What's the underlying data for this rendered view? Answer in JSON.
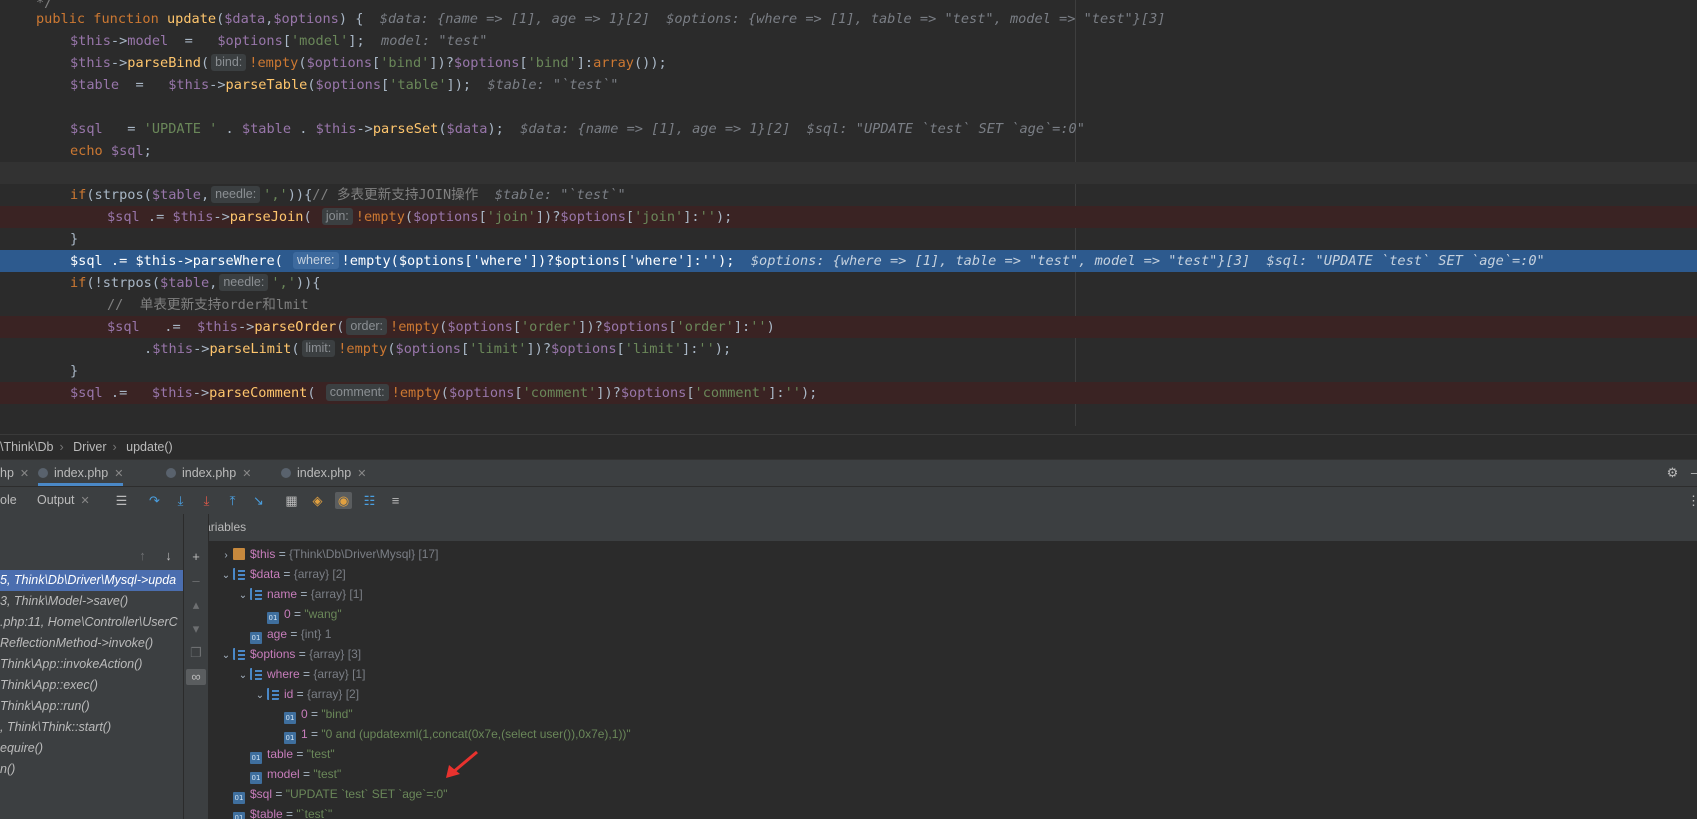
{
  "editor": {
    "lines": [
      {
        "tokens": [
          [
            "cmt",
            "*/"
          ]
        ]
      },
      {
        "tokens": [
          [
            "kw",
            "public function "
          ],
          [
            "fn",
            "update"
          ],
          [
            "plain",
            "("
          ],
          [
            "var",
            "$data"
          ],
          [
            "plain",
            ","
          ],
          [
            "var",
            "$options"
          ],
          [
            "plain",
            ") {  "
          ],
          [
            "inl",
            "$data: {name => [1], age => 1}[2]  $options: {where => [1], table => \"test\", model => \"test\"}[3]"
          ]
        ]
      },
      {
        "tokens": [
          [
            "var",
            "$this"
          ],
          [
            "plain",
            "->"
          ],
          [
            "var",
            "model"
          ],
          [
            "plain",
            "  =   "
          ],
          [
            "var",
            "$options"
          ],
          [
            "plain",
            "["
          ],
          [
            "str",
            "'model'"
          ],
          [
            "plain",
            "];  "
          ],
          [
            "inl",
            "model: \"test\""
          ]
        ]
      },
      {
        "tokens": [
          [
            "var",
            "$this"
          ],
          [
            "plain",
            "->"
          ],
          [
            "fn",
            "parseBind"
          ],
          [
            "plain",
            "("
          ],
          [
            "hint",
            "bind:"
          ],
          [
            "kw",
            "!empty"
          ],
          [
            "plain",
            "("
          ],
          [
            "var",
            "$options"
          ],
          [
            "plain",
            "["
          ],
          [
            "str",
            "'bind'"
          ],
          [
            "plain",
            "])?"
          ],
          [
            "var",
            "$options"
          ],
          [
            "plain",
            "["
          ],
          [
            "str",
            "'bind'"
          ],
          [
            "plain",
            "]:"
          ],
          [
            "kw",
            "array"
          ],
          [
            "plain",
            "());"
          ]
        ]
      },
      {
        "tokens": [
          [
            "var",
            "$table"
          ],
          [
            "plain",
            "  =   "
          ],
          [
            "var",
            "$this"
          ],
          [
            "plain",
            "->"
          ],
          [
            "fn",
            "parseTable"
          ],
          [
            "plain",
            "("
          ],
          [
            "var",
            "$options"
          ],
          [
            "plain",
            "["
          ],
          [
            "str",
            "'table'"
          ],
          [
            "plain",
            "]);  "
          ],
          [
            "inl",
            "$table: \"`test`\""
          ]
        ]
      },
      {
        "tokens": []
      },
      {
        "tokens": [
          [
            "var",
            "$sql"
          ],
          [
            "plain",
            "   = "
          ],
          [
            "str",
            "'UPDATE '"
          ],
          [
            "plain",
            " . "
          ],
          [
            "var",
            "$table"
          ],
          [
            "plain",
            " . "
          ],
          [
            "var",
            "$this"
          ],
          [
            "plain",
            "->"
          ],
          [
            "fn",
            "parseSet"
          ],
          [
            "plain",
            "("
          ],
          [
            "var",
            "$data"
          ],
          [
            "plain",
            ");  "
          ],
          [
            "inl",
            "$data: {name => [1], age => 1}[2]  $sql: \"UPDATE `test` SET `age`=:0\""
          ]
        ]
      },
      {
        "tokens": [
          [
            "kw",
            "echo "
          ],
          [
            "var",
            "$sql"
          ],
          [
            "plain",
            ";"
          ]
        ]
      },
      {
        "tokens": []
      },
      {
        "tokens": [
          [
            "kw",
            "if"
          ],
          [
            "plain",
            "(strpos("
          ],
          [
            "var",
            "$table"
          ],
          [
            "plain",
            ","
          ],
          [
            "hint",
            "needle:"
          ],
          [
            "str",
            "','"
          ],
          [
            "plain",
            "))"
          ],
          [
            "plain",
            "{"
          ],
          [
            "cmt",
            "// 多表更新支持JOIN操作  "
          ],
          [
            "inl",
            "$table: \"`test`\""
          ]
        ]
      },
      {
        "tokens": [
          [
            "var",
            "$sql"
          ],
          [
            "plain",
            " .= "
          ],
          [
            "var",
            "$this"
          ],
          [
            "plain",
            "->"
          ],
          [
            "fn",
            "parseJoin"
          ],
          [
            "plain",
            "( "
          ],
          [
            "hint",
            "join:"
          ],
          [
            "kw",
            "!empty"
          ],
          [
            "plain",
            "("
          ],
          [
            "var",
            "$options"
          ],
          [
            "plain",
            "["
          ],
          [
            "str",
            "'join'"
          ],
          [
            "plain",
            "])?"
          ],
          [
            "var",
            "$options"
          ],
          [
            "plain",
            "["
          ],
          [
            "str",
            "'join'"
          ],
          [
            "plain",
            "]:"
          ],
          [
            "str",
            "''"
          ],
          [
            "plain",
            ");"
          ]
        ]
      },
      {
        "tokens": [
          [
            "plain",
            "}"
          ]
        ]
      },
      {
        "tokens": [
          [
            "var",
            "$sql"
          ],
          [
            "plain",
            " .= "
          ],
          [
            "var",
            "$this"
          ],
          [
            "plain",
            "->"
          ],
          [
            "fn",
            "parseWhere"
          ],
          [
            "plain",
            "( "
          ],
          [
            "hint",
            "where:"
          ],
          [
            "kw",
            "!empty"
          ],
          [
            "plain",
            "("
          ],
          [
            "var",
            "$options"
          ],
          [
            "plain",
            "["
          ],
          [
            "str",
            "'where'"
          ],
          [
            "plain",
            "])?"
          ],
          [
            "var",
            "$options"
          ],
          [
            "plain",
            "["
          ],
          [
            "str",
            "'where'"
          ],
          [
            "plain",
            "]:"
          ],
          [
            "str",
            "''"
          ],
          [
            "plain",
            ");  "
          ],
          [
            "inl",
            "$options: {where => [1], table => \"test\", model => \"test\"}[3]  $sql: \"UPDATE `test` SET `age`=:0\""
          ]
        ]
      },
      {
        "tokens": [
          [
            "kw",
            "if"
          ],
          [
            "plain",
            "(!strpos("
          ],
          [
            "var",
            "$table"
          ],
          [
            "plain",
            ","
          ],
          [
            "hint",
            "needle:"
          ],
          [
            "str",
            "','"
          ],
          [
            "plain",
            ")){"
          ]
        ]
      },
      {
        "tokens": [
          [
            "cmt",
            "//  单表更新支持order和lmit"
          ]
        ]
      },
      {
        "tokens": [
          [
            "var",
            "$sql"
          ],
          [
            "plain",
            "   .=  "
          ],
          [
            "var",
            "$this"
          ],
          [
            "plain",
            "->"
          ],
          [
            "fn",
            "parseOrder"
          ],
          [
            "plain",
            "("
          ],
          [
            "hint",
            "order:"
          ],
          [
            "kw",
            "!empty"
          ],
          [
            "plain",
            "("
          ],
          [
            "var",
            "$options"
          ],
          [
            "plain",
            "["
          ],
          [
            "str",
            "'order'"
          ],
          [
            "plain",
            "])?"
          ],
          [
            "var",
            "$options"
          ],
          [
            "plain",
            "["
          ],
          [
            "str",
            "'order'"
          ],
          [
            "plain",
            "]:"
          ],
          [
            "str",
            "''"
          ],
          [
            "plain",
            ")"
          ]
        ]
      },
      {
        "tokens": [
          [
            "plain",
            "."
          ],
          [
            "var",
            "$this"
          ],
          [
            "plain",
            "->"
          ],
          [
            "fn",
            "parseLimit"
          ],
          [
            "plain",
            "("
          ],
          [
            "hint",
            "limit:"
          ],
          [
            "kw",
            "!empty"
          ],
          [
            "plain",
            "("
          ],
          [
            "var",
            "$options"
          ],
          [
            "plain",
            "["
          ],
          [
            "str",
            "'limit'"
          ],
          [
            "plain",
            "])?"
          ],
          [
            "var",
            "$options"
          ],
          [
            "plain",
            "["
          ],
          [
            "str",
            "'limit'"
          ],
          [
            "plain",
            "]:"
          ],
          [
            "str",
            "''"
          ],
          [
            "plain",
            ");"
          ]
        ]
      },
      {
        "tokens": [
          [
            "plain",
            "}"
          ]
        ]
      },
      {
        "tokens": [
          [
            "var",
            "$sql"
          ],
          [
            "plain",
            " .=   "
          ],
          [
            "var",
            "$this"
          ],
          [
            "plain",
            "->"
          ],
          [
            "fn",
            "parseComment"
          ],
          [
            "plain",
            "( "
          ],
          [
            "hint",
            "comment:"
          ],
          [
            "kw",
            "!empty"
          ],
          [
            "plain",
            "("
          ],
          [
            "var",
            "$options"
          ],
          [
            "plain",
            "["
          ],
          [
            "str",
            "'comment'"
          ],
          [
            "plain",
            "])?"
          ],
          [
            "var",
            "$options"
          ],
          [
            "plain",
            "["
          ],
          [
            "str",
            "'comment'"
          ],
          [
            "plain",
            "]:"
          ],
          [
            "str",
            "''"
          ],
          [
            "plain",
            ");"
          ]
        ]
      },
      {
        "tokens": []
      }
    ]
  },
  "breadcrumb": [
    "\\Think\\Db",
    "Driver",
    "update()"
  ],
  "file_tabs": [
    "hp",
    "index.php",
    "index.php",
    "index.php"
  ],
  "toolbar": {
    "console_label": "ole",
    "output_label": "Output"
  },
  "frames_panel": {
    "items": [
      "5, Think\\Db\\Driver\\Mysql->upda",
      "3, Think\\Model->save()",
      ".php:11, Home\\Controller\\UserC",
      "ReflectionMethod->invoke()",
      "Think\\App::invokeAction()",
      "Think\\App::exec()",
      "Think\\App::run()",
      ", Think\\Think::start()",
      "equire()",
      "n()"
    ]
  },
  "variables": {
    "header": "Variables",
    "rows": [
      {
        "name": "$this",
        "type": "{Think\\Db\\Driver\\Mysql} [17]",
        "value": ""
      },
      {
        "name": "$data",
        "type": "{array} [2]",
        "value": ""
      },
      {
        "name": "name",
        "type": "{array} [1]",
        "value": ""
      },
      {
        "name": "0",
        "type": "",
        "value": "\"wang\""
      },
      {
        "name": "age",
        "type": "{int} 1",
        "value": ""
      },
      {
        "name": "$options",
        "type": "{array} [3]",
        "value": ""
      },
      {
        "name": "where",
        "type": "{array} [1]",
        "value": ""
      },
      {
        "name": "id",
        "type": "{array} [2]",
        "value": ""
      },
      {
        "name": "0",
        "type": "",
        "value": "\"bind\""
      },
      {
        "name": "1",
        "type": "",
        "value": "\"0 and (updatexml(1,concat(0x7e,(select user()),0x7e),1))\""
      },
      {
        "name": "table",
        "type": "",
        "value": "\"test\""
      },
      {
        "name": "model",
        "type": "",
        "value": "\"test\""
      },
      {
        "name": "$sql",
        "type": "",
        "value": "\"UPDATE `test` SET `age`=:0\""
      },
      {
        "name": "$table",
        "type": "",
        "value": "\"`test`\""
      }
    ]
  },
  "colors": {
    "execution_line": "#2d5a8e",
    "breakpoint_line": "#3a2323",
    "selected_frame": "#4b6eaf",
    "annotation_arrow": "#e8322e"
  }
}
